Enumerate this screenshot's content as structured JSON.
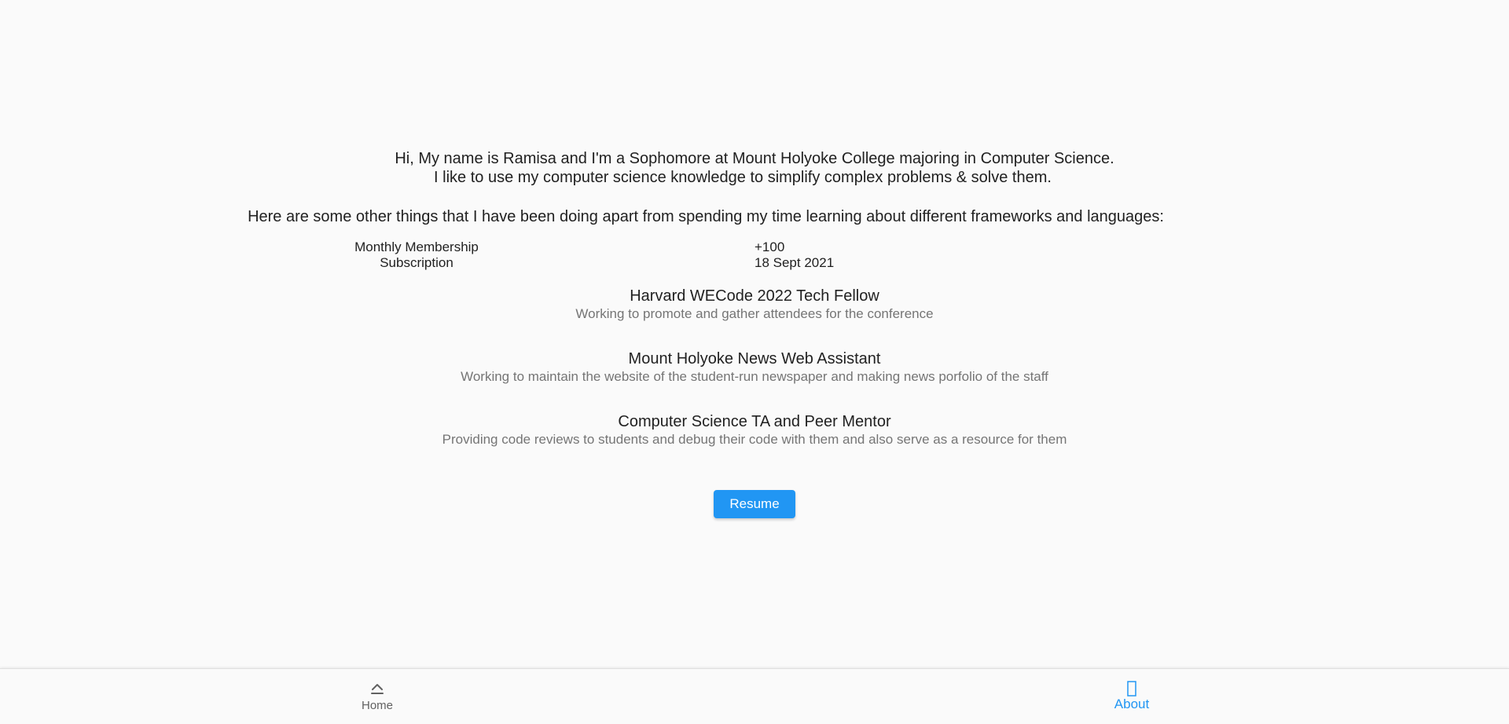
{
  "intro": {
    "line1": "Hi, My name is Ramisa and I'm a Sophomore at Mount Holyoke College majoring in Computer Science.",
    "line2": "I like to use my computer science knowledge to simplify complex problems & solve them."
  },
  "others_heading": "Here are some other things that I have been doing apart from spending my time learning about different frameworks and languages:",
  "membership": {
    "label_line1": "Monthly Membership",
    "label_line2": "Subscription",
    "value": "+100",
    "date": "18 Sept 2021"
  },
  "activities": [
    {
      "title": "Harvard WECode 2022 Tech Fellow",
      "description": "Working to promote and gather attendees for the conference"
    },
    {
      "title": "Mount Holyoke News Web Assistant",
      "description": "Working to maintain the website of the student-run newspaper and making news porfolio of the staff"
    },
    {
      "title": "Computer Science TA and Peer Mentor",
      "description": "Providing code reviews to students and debug their code with them and also serve as a resource for them"
    }
  ],
  "resume_button": "Resume",
  "bottom_nav": {
    "items": [
      {
        "label": "Home",
        "icon": "home-icon",
        "active": false
      },
      {
        "label": "About",
        "icon": "info-icon",
        "active": true
      }
    ],
    "active_color": "#2196f3",
    "inactive_color": "#616161"
  },
  "colors": {
    "background": "#fafafa",
    "accent": "#2196f3",
    "text_primary": "#212121",
    "text_secondary": "#757575"
  }
}
